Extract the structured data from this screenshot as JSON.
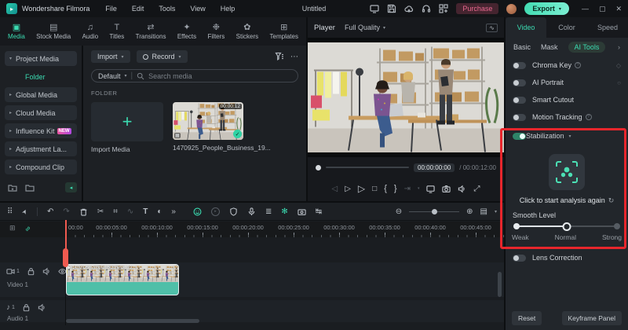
{
  "titlebar": {
    "app_name": "Wondershare Filmora",
    "menus": [
      "File",
      "Edit",
      "Tools",
      "View",
      "Help"
    ],
    "document_title": "Untitled",
    "purchase_label": "Purchase",
    "export_label": "Export"
  },
  "library": {
    "active_tab": "Media",
    "tabs": [
      {
        "label": "Media"
      },
      {
        "label": "Stock Media"
      },
      {
        "label": "Audio"
      },
      {
        "label": "Titles"
      },
      {
        "label": "Transitions"
      },
      {
        "label": "Effects"
      },
      {
        "label": "Filters"
      },
      {
        "label": "Stickers"
      },
      {
        "label": "Templates"
      }
    ],
    "sidebar": {
      "items": [
        {
          "label": "Project Media"
        },
        {
          "label": "Folder"
        },
        {
          "label": "Global Media"
        },
        {
          "label": "Cloud Media"
        },
        {
          "label": "Influence Kit",
          "badge": "NEW"
        },
        {
          "label": "Adjustment La..."
        },
        {
          "label": "Compound Clip"
        }
      ]
    },
    "toolbar": {
      "import_label": "Import",
      "record_label": "Record",
      "sort_label": "Default",
      "search_placeholder": "Search media"
    },
    "section_label": "FOLDER",
    "import_tile_label": "Import Media",
    "clip": {
      "name": "1470925_People_Business_19...",
      "duration": "00:00:12"
    }
  },
  "player": {
    "label": "Player",
    "quality": "Full Quality",
    "current_time": "00:00:00:00",
    "duration": "00:00:12:00"
  },
  "inspector": {
    "tabs": [
      {
        "label": "Video"
      },
      {
        "label": "Color"
      },
      {
        "label": "Speed"
      }
    ],
    "active_tab": "Video",
    "subtabs": [
      {
        "label": "Basic"
      },
      {
        "label": "Mask"
      },
      {
        "label": "AI Tools"
      }
    ],
    "active_subtab": "AI Tools",
    "toggles": [
      {
        "label": "Chroma Key",
        "state": "off"
      },
      {
        "label": "AI Portrait",
        "state": "off"
      },
      {
        "label": "Smart Cutout",
        "state": "off"
      },
      {
        "label": "Motion Tracking",
        "state": "off"
      }
    ],
    "stabilization": {
      "label": "Stabilization",
      "state": "on",
      "analysis_label": "Click to start analysis again",
      "smooth_label": "Smooth Level",
      "marks": [
        "Weak",
        "Normal",
        "Strong"
      ],
      "level": "Normal"
    },
    "lens_label": "Lens Correction",
    "reset_label": "Reset",
    "keyframe_panel_label": "Keyframe Panel"
  },
  "timeline": {
    "ruler_labels": [
      "00:00",
      "00:00:05:00",
      "00:00:10:00",
      "00:00:15:00",
      "00:00:20:00",
      "00:00:25:00",
      "00:00:30:00",
      "00:00:35:00",
      "00:00:40:00",
      "00:00:45:00"
    ],
    "video_track_label": "Video 1",
    "audio_track_label": "Audio 1",
    "playhead_time": "00:00"
  },
  "colors": {
    "accent_teal": "#3bdcb2",
    "highlight_red": "#e8262c",
    "purchase_pink": "#e9688f",
    "clip_teal": "#4fbfa8",
    "playhead_red": "#ef5a50",
    "badge_gradient": "#e9529e"
  },
  "icons": {
    "logo_play": "▸",
    "caret_down": "▾",
    "arrow_right": "▸",
    "arrow_down": "▾",
    "chevron_left": "◂",
    "chevron_right": "›",
    "more": "⋯",
    "divider": "|",
    "tab_media": "▣",
    "tab_stock": "▤",
    "tab_audio": "♫",
    "tab_titles": "T",
    "tab_transitions": "⇄",
    "tab_effects": "✦",
    "tab_filters": "❉",
    "tab_stickers": "✿",
    "tab_templates": "⊞",
    "plus": "+",
    "check": "✓",
    "clip_badge": "▦",
    "scopes": "∿",
    "prev_frame": "◁",
    "next_frame": "▷",
    "play": "▷",
    "stop": "□",
    "mark_in": "{",
    "mark_out": "}",
    "render": "⇥",
    "expand": "⤢",
    "grid_tools": "⠿",
    "select_tool": "➤",
    "undo": "↶",
    "redo": "↷",
    "split": "✂",
    "crop": "⌗",
    "speed_ramp": "∿",
    "text_tool": "T",
    "mask_tool": "◐",
    "more_tools": "»",
    "play_circle": "▸",
    "mixer": "≣",
    "beat_detect": "✻",
    "auto_ripple": "↹",
    "zoom_out": "⊖",
    "zoom_in": "⊕",
    "track_height": "▤",
    "add_to_track": "⊞",
    "link_clip": "∞",
    "music_note": "♪",
    "keyframe_diamond": "◇",
    "keyframe_circle": "○",
    "help": "?",
    "refresh": "↻",
    "window_min": "—",
    "window_max": "▢",
    "window_close": "✕"
  }
}
